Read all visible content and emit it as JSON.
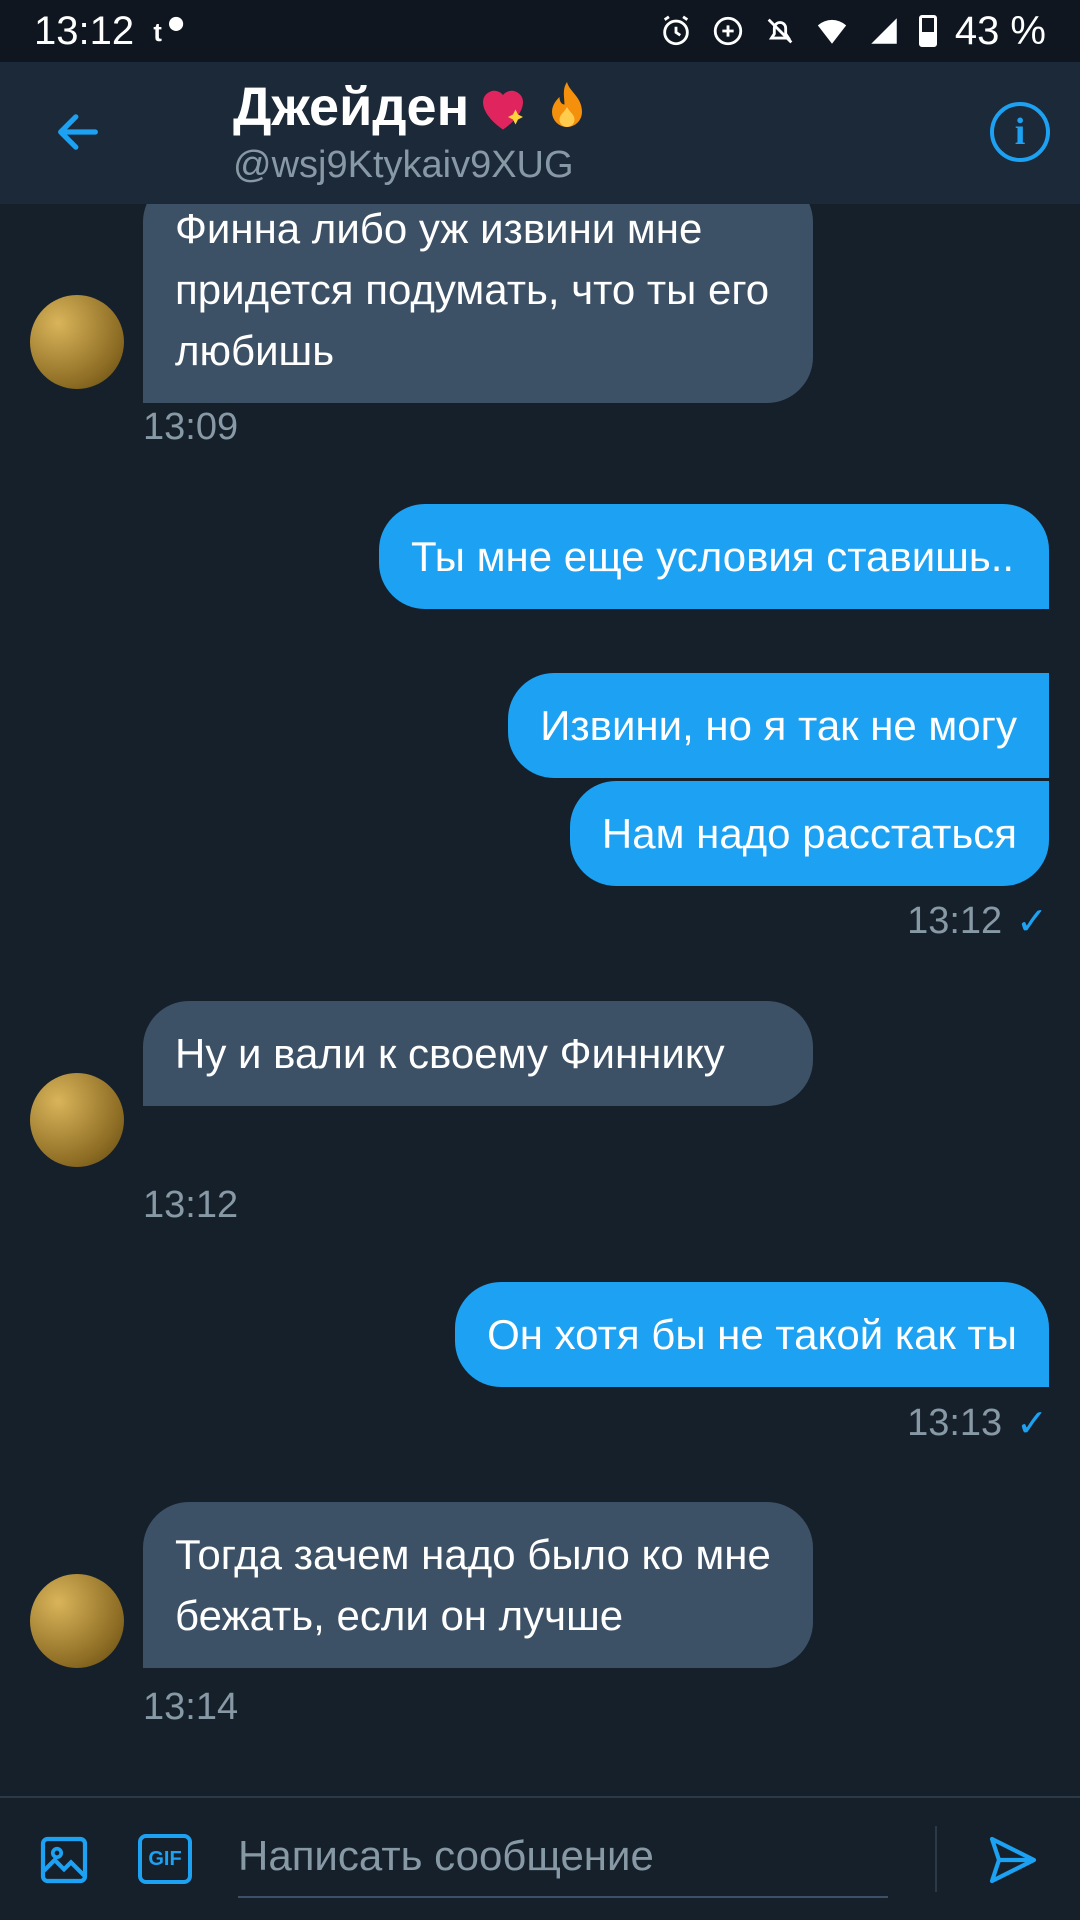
{
  "status_bar": {
    "time": "13:12",
    "notif_icon": "t-notification-icon",
    "battery": "43 %",
    "icons": [
      "alarm-icon",
      "data-saver-icon",
      "bell-off-icon",
      "wifi-icon",
      "signal-icon",
      "battery-icon"
    ]
  },
  "header": {
    "name": "Джейден",
    "handle": "@wsj9Ktykaiv9XUG",
    "info_label": "i"
  },
  "messages": [
    {
      "direction": "in",
      "text": "Финна либо уж извини мне придется подумать, что ты его любишь",
      "time": "13:09"
    },
    {
      "direction": "out",
      "text": "Ты мне еще условия ставишь.."
    },
    {
      "direction": "out",
      "text": "Извини, но я так не могу"
    },
    {
      "direction": "out",
      "text": "Нам надо расстаться",
      "time": "13:12",
      "check": "✓"
    },
    {
      "direction": "in",
      "text": "Ну и вали к своему Финнику",
      "time": "13:12"
    },
    {
      "direction": "out",
      "text": "Он хотя бы не такой как ты",
      "time": "13:13",
      "check": "✓"
    },
    {
      "direction": "in",
      "text": "Тогда зачем надо было ко мне бежать, если он лучше",
      "time": "13:14"
    }
  ],
  "composer": {
    "placeholder": "Написать сообщение",
    "gif_label": "GIF"
  },
  "colors": {
    "background": "#15202b",
    "header": "#1c2938",
    "accent": "#1da1f2",
    "incoming_bubble": "#3d5166",
    "muted_text": "#8899a6"
  }
}
